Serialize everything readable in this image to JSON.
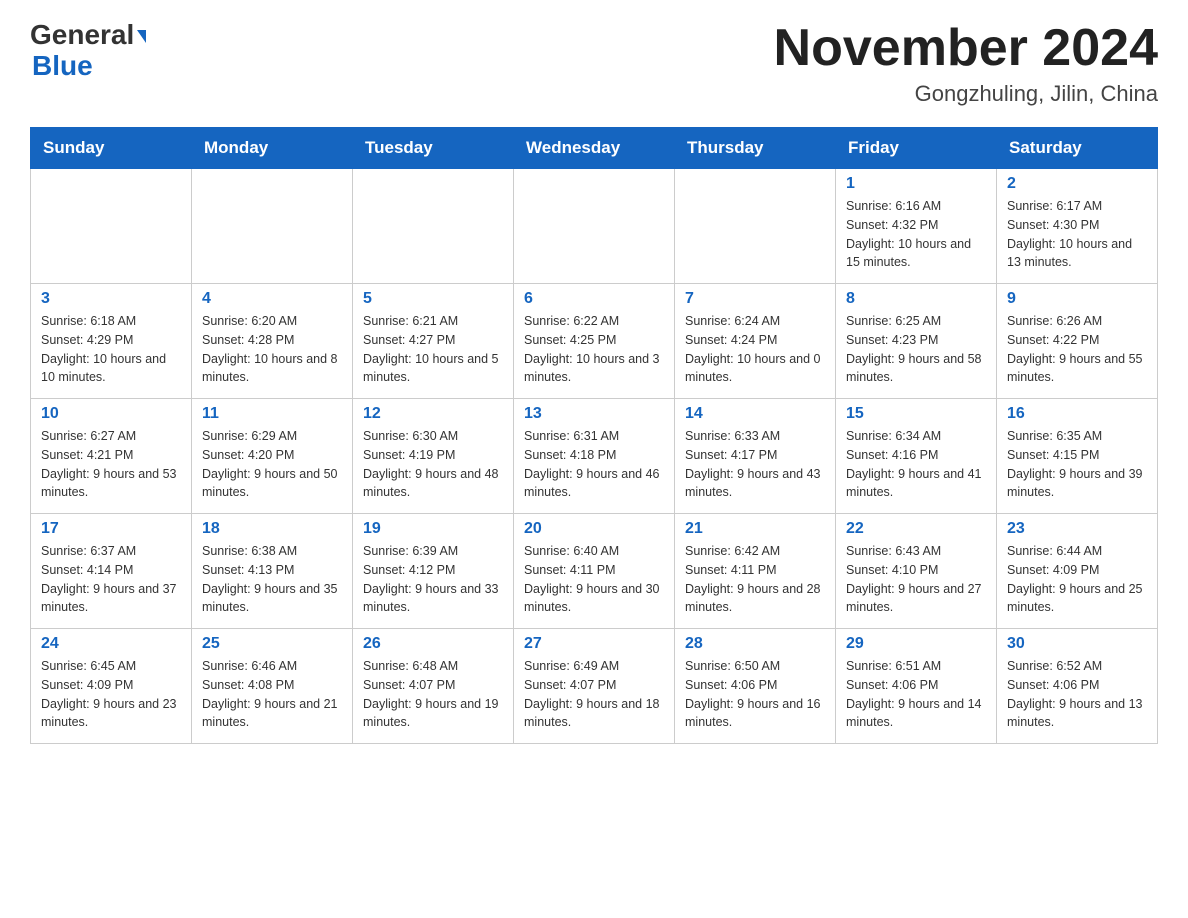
{
  "header": {
    "logo_general": "General",
    "logo_blue": "Blue",
    "month_title": "November 2024",
    "location": "Gongzhuling, Jilin, China"
  },
  "weekdays": [
    "Sunday",
    "Monday",
    "Tuesday",
    "Wednesday",
    "Thursday",
    "Friday",
    "Saturday"
  ],
  "weeks": [
    [
      {
        "day": "",
        "info": ""
      },
      {
        "day": "",
        "info": ""
      },
      {
        "day": "",
        "info": ""
      },
      {
        "day": "",
        "info": ""
      },
      {
        "day": "",
        "info": ""
      },
      {
        "day": "1",
        "info": "Sunrise: 6:16 AM\nSunset: 4:32 PM\nDaylight: 10 hours and 15 minutes."
      },
      {
        "day": "2",
        "info": "Sunrise: 6:17 AM\nSunset: 4:30 PM\nDaylight: 10 hours and 13 minutes."
      }
    ],
    [
      {
        "day": "3",
        "info": "Sunrise: 6:18 AM\nSunset: 4:29 PM\nDaylight: 10 hours and 10 minutes."
      },
      {
        "day": "4",
        "info": "Sunrise: 6:20 AM\nSunset: 4:28 PM\nDaylight: 10 hours and 8 minutes."
      },
      {
        "day": "5",
        "info": "Sunrise: 6:21 AM\nSunset: 4:27 PM\nDaylight: 10 hours and 5 minutes."
      },
      {
        "day": "6",
        "info": "Sunrise: 6:22 AM\nSunset: 4:25 PM\nDaylight: 10 hours and 3 minutes."
      },
      {
        "day": "7",
        "info": "Sunrise: 6:24 AM\nSunset: 4:24 PM\nDaylight: 10 hours and 0 minutes."
      },
      {
        "day": "8",
        "info": "Sunrise: 6:25 AM\nSunset: 4:23 PM\nDaylight: 9 hours and 58 minutes."
      },
      {
        "day": "9",
        "info": "Sunrise: 6:26 AM\nSunset: 4:22 PM\nDaylight: 9 hours and 55 minutes."
      }
    ],
    [
      {
        "day": "10",
        "info": "Sunrise: 6:27 AM\nSunset: 4:21 PM\nDaylight: 9 hours and 53 minutes."
      },
      {
        "day": "11",
        "info": "Sunrise: 6:29 AM\nSunset: 4:20 PM\nDaylight: 9 hours and 50 minutes."
      },
      {
        "day": "12",
        "info": "Sunrise: 6:30 AM\nSunset: 4:19 PM\nDaylight: 9 hours and 48 minutes."
      },
      {
        "day": "13",
        "info": "Sunrise: 6:31 AM\nSunset: 4:18 PM\nDaylight: 9 hours and 46 minutes."
      },
      {
        "day": "14",
        "info": "Sunrise: 6:33 AM\nSunset: 4:17 PM\nDaylight: 9 hours and 43 minutes."
      },
      {
        "day": "15",
        "info": "Sunrise: 6:34 AM\nSunset: 4:16 PM\nDaylight: 9 hours and 41 minutes."
      },
      {
        "day": "16",
        "info": "Sunrise: 6:35 AM\nSunset: 4:15 PM\nDaylight: 9 hours and 39 minutes."
      }
    ],
    [
      {
        "day": "17",
        "info": "Sunrise: 6:37 AM\nSunset: 4:14 PM\nDaylight: 9 hours and 37 minutes."
      },
      {
        "day": "18",
        "info": "Sunrise: 6:38 AM\nSunset: 4:13 PM\nDaylight: 9 hours and 35 minutes."
      },
      {
        "day": "19",
        "info": "Sunrise: 6:39 AM\nSunset: 4:12 PM\nDaylight: 9 hours and 33 minutes."
      },
      {
        "day": "20",
        "info": "Sunrise: 6:40 AM\nSunset: 4:11 PM\nDaylight: 9 hours and 30 minutes."
      },
      {
        "day": "21",
        "info": "Sunrise: 6:42 AM\nSunset: 4:11 PM\nDaylight: 9 hours and 28 minutes."
      },
      {
        "day": "22",
        "info": "Sunrise: 6:43 AM\nSunset: 4:10 PM\nDaylight: 9 hours and 27 minutes."
      },
      {
        "day": "23",
        "info": "Sunrise: 6:44 AM\nSunset: 4:09 PM\nDaylight: 9 hours and 25 minutes."
      }
    ],
    [
      {
        "day": "24",
        "info": "Sunrise: 6:45 AM\nSunset: 4:09 PM\nDaylight: 9 hours and 23 minutes."
      },
      {
        "day": "25",
        "info": "Sunrise: 6:46 AM\nSunset: 4:08 PM\nDaylight: 9 hours and 21 minutes."
      },
      {
        "day": "26",
        "info": "Sunrise: 6:48 AM\nSunset: 4:07 PM\nDaylight: 9 hours and 19 minutes."
      },
      {
        "day": "27",
        "info": "Sunrise: 6:49 AM\nSunset: 4:07 PM\nDaylight: 9 hours and 18 minutes."
      },
      {
        "day": "28",
        "info": "Sunrise: 6:50 AM\nSunset: 4:06 PM\nDaylight: 9 hours and 16 minutes."
      },
      {
        "day": "29",
        "info": "Sunrise: 6:51 AM\nSunset: 4:06 PM\nDaylight: 9 hours and 14 minutes."
      },
      {
        "day": "30",
        "info": "Sunrise: 6:52 AM\nSunset: 4:06 PM\nDaylight: 9 hours and 13 minutes."
      }
    ]
  ]
}
